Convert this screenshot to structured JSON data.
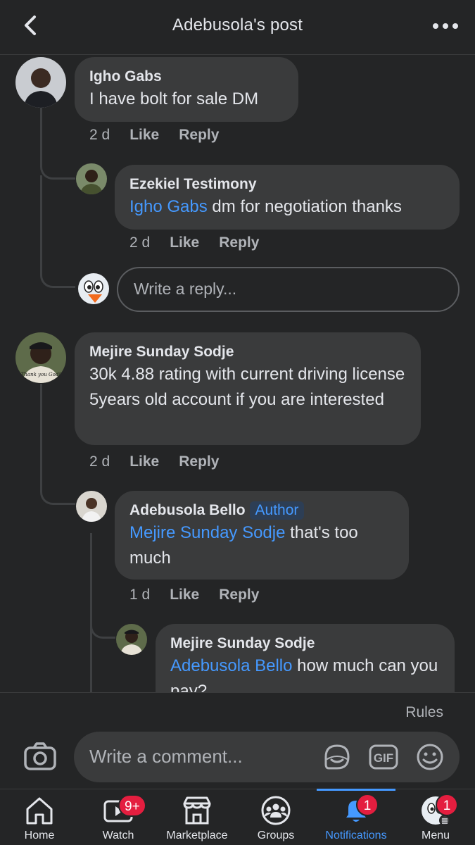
{
  "header": {
    "title": "Adebusola's post"
  },
  "comments": [
    {
      "name": "Igho Gabs",
      "text": "I have bolt for sale DM",
      "time": "2 d",
      "like": "Like",
      "reply": "Reply"
    },
    {
      "name": "Ezekiel Testimony",
      "mention": "Igho Gabs",
      "text": " dm for negotiation thanks",
      "time": "2 d",
      "like": "Like",
      "reply": "Reply"
    },
    {
      "name": "Mejire Sunday Sodje",
      "text": "30k 4.88 rating with current driving license 5years old account if you are interested",
      "time": "2 d",
      "like": "Like",
      "reply": "Reply"
    },
    {
      "name": "Adebusola Bello",
      "badge": "Author",
      "mention": "Mejire Sunday Sodje",
      "text": " that's too much",
      "time": "1 d",
      "like": "Like",
      "reply": "Reply"
    },
    {
      "name": "Mejire Sunday Sodje",
      "mention": "Adebusola Bello",
      "text": " how much can you pay?"
    }
  ],
  "reply_box": {
    "placeholder": "Write a reply..."
  },
  "composer": {
    "rules": "Rules",
    "placeholder": "Write a comment...",
    "gif_label": "GIF",
    "icons": [
      "camera-icon",
      "sticker-icon",
      "gif-icon",
      "emoji-icon"
    ]
  },
  "tabs": [
    {
      "label": "Home",
      "icon": "home-icon"
    },
    {
      "label": "Watch",
      "icon": "watch-icon",
      "badge": "9+"
    },
    {
      "label": "Marketplace",
      "icon": "marketplace-icon"
    },
    {
      "label": "Groups",
      "icon": "groups-icon"
    },
    {
      "label": "Notifications",
      "icon": "bell-icon",
      "badge": "1",
      "active": true
    },
    {
      "label": "Menu",
      "icon": "menu-avatar-icon",
      "badge": "1"
    }
  ],
  "colors": {
    "background": "#242526",
    "bubble": "#3a3b3c",
    "accent": "#4599ff",
    "badge": "#e41e3f",
    "secondary_text": "#b0b3b8"
  }
}
